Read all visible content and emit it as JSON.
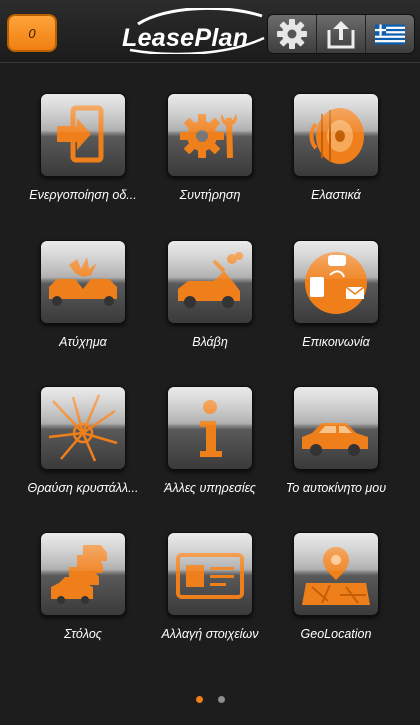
{
  "header": {
    "counter": "0",
    "logo_text": "LeasePlan",
    "buttons": [
      {
        "name": "settings",
        "icon": "gear-icon"
      },
      {
        "name": "share",
        "icon": "share-upload-icon"
      },
      {
        "name": "language",
        "icon": "greek-flag-icon"
      }
    ]
  },
  "colors": {
    "accent": "#ef7f1a",
    "background": "#1d1d1d"
  },
  "menu": [
    {
      "label": "Ενεργοποίηση οδ...",
      "icon": "sign-in-door-icon"
    },
    {
      "label": "Συντήρηση",
      "icon": "gear-wrench-icon"
    },
    {
      "label": "Ελαστικά",
      "icon": "tire-icon"
    },
    {
      "label": "Ατύχημα",
      "icon": "car-crash-icon"
    },
    {
      "label": "Βλάβη",
      "icon": "car-breakdown-icon"
    },
    {
      "label": "Επικοινωνία",
      "icon": "contact-icon"
    },
    {
      "label": "Θραύση κρυστάλλ...",
      "icon": "broken-glass-icon"
    },
    {
      "label": "Άλλες υπηρεσίες",
      "icon": "info-icon"
    },
    {
      "label": "Το αυτοκίνητο μου",
      "icon": "car-icon"
    },
    {
      "label": "Στόλος",
      "icon": "fleet-icon"
    },
    {
      "label": "Αλλαγή στοιχείων",
      "icon": "id-card-icon"
    },
    {
      "label": "GeoLocation",
      "icon": "map-pin-icon"
    }
  ],
  "pager": {
    "pages": 2,
    "current": 1
  }
}
